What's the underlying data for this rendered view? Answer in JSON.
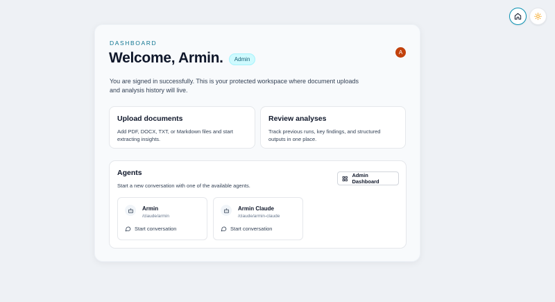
{
  "top_controls": {
    "home_icon": "home-icon",
    "theme_icon": "sun-icon"
  },
  "dashboard": {
    "eyebrow": "DASHBOARD",
    "title": "Welcome, Armin.",
    "role_badge": "Admin",
    "avatar_initial": "A",
    "intro": "You are signed in successfully. This is your protected workspace where document uploads and analysis history will live."
  },
  "tiles": [
    {
      "title": "Upload documents",
      "description": "Add PDF, DOCX, TXT, or Markdown files and start extracting insights."
    },
    {
      "title": "Review analyses",
      "description": "Track previous runs, key findings, and structured outputs in one place."
    }
  ],
  "agents": {
    "title": "Agents",
    "subtitle": "Start a new conversation with one of the available agents.",
    "admin_button_label": "Admin Dashboard",
    "items": [
      {
        "name": "Armin",
        "path": "/claude/armin",
        "action_label": "Start conversation"
      },
      {
        "name": "Armin Claude",
        "path": "/claude/armin-claude",
        "action_label": "Start conversation"
      }
    ]
  },
  "colors": {
    "accent": "#0891b2",
    "avatar": "#c2410c",
    "badge_bg": "#cffafe",
    "page_bg": "#eef1f5"
  }
}
